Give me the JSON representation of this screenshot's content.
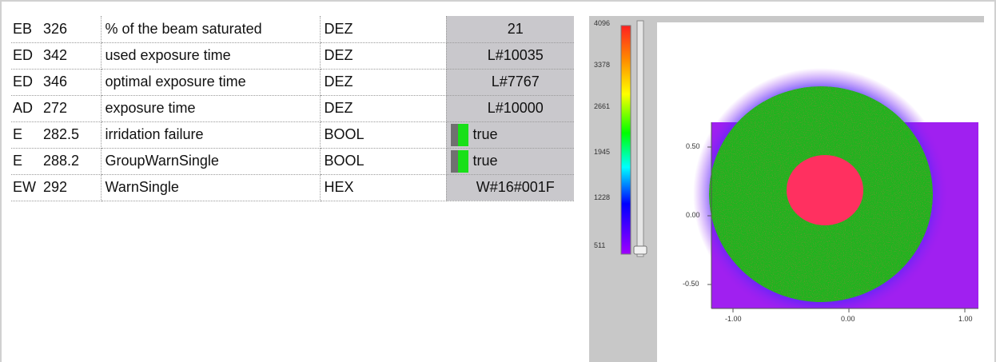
{
  "variable_table": {
    "rows": [
      {
        "operand": "EB",
        "address": "326",
        "comment": "% of the beam saturated",
        "format": "DEZ",
        "value": "21",
        "kind": "num"
      },
      {
        "operand": "ED",
        "address": "342",
        "comment": "used exposure time",
        "format": "DEZ",
        "value": "L#10035",
        "kind": "num"
      },
      {
        "operand": "ED",
        "address": "346",
        "comment": "optimal exposure time",
        "format": "DEZ",
        "value": "L#7767",
        "kind": "num"
      },
      {
        "operand": "AD",
        "address": "272",
        "comment": "exposure time",
        "format": "DEZ",
        "value": "L#10000",
        "kind": "num"
      },
      {
        "operand": "E",
        "address": "282.5",
        "comment": "irridation failure",
        "format": "BOOL",
        "value": "true",
        "kind": "bool"
      },
      {
        "operand": "E",
        "address": "288.2",
        "comment": "GroupWarnSingle",
        "format": "BOOL",
        "value": "true",
        "kind": "bool"
      },
      {
        "operand": "EW",
        "address": "292",
        "comment": "WarnSingle",
        "format": "HEX",
        "value": "W#16#001F",
        "kind": "num"
      }
    ]
  },
  "beam_profile": {
    "colorbar": {
      "labels": [
        "4096",
        "3378",
        "2661",
        "1945",
        "1228",
        "511"
      ],
      "colors": [
        "#ff2020",
        "#ff8c00",
        "#ffff00",
        "#00ff00",
        "#00ffff",
        "#0000ff",
        "#a000ff"
      ],
      "slider_value": 511
    },
    "y_ticks": [
      "0.50",
      "0.00",
      "-0.50"
    ],
    "x_ticks": [
      "-1.00",
      "0.00",
      "1.00"
    ],
    "colors": {
      "background": "#a020f0",
      "halo": "#2a2aff",
      "body": "#1eb41e",
      "hotspot": "#ff3060"
    }
  }
}
